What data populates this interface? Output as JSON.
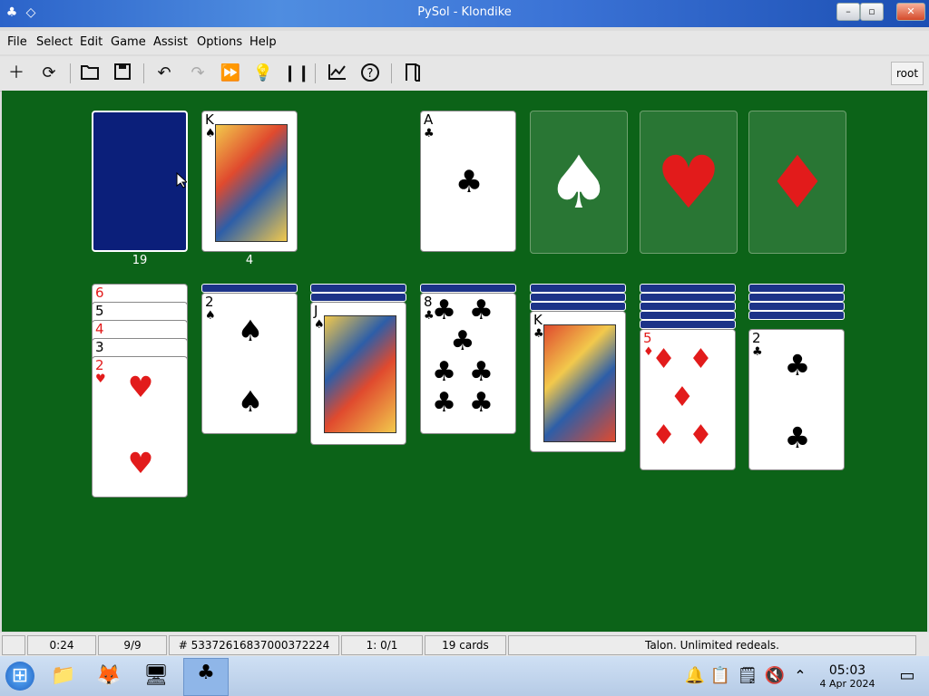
{
  "window": {
    "title": "PySol - Klondike"
  },
  "menu": [
    "File",
    "Select",
    "Edit",
    "Game",
    "Assist",
    "Options",
    "Help"
  ],
  "toolbar": {
    "user": "root"
  },
  "stock": {
    "count": "19"
  },
  "waste": {
    "count": "4",
    "top": {
      "rank": "K",
      "suit": "♠"
    }
  },
  "foundations": [
    {
      "rank": "A",
      "suit": "♣",
      "color": "#000000"
    },
    {
      "suit": "♠",
      "empty": true
    },
    {
      "suit": "♥",
      "empty": true,
      "color": "#e21b1b"
    },
    {
      "suit": "♦",
      "empty": true,
      "color": "#e21b1b"
    }
  ],
  "tableau": [
    {
      "hidden": 0,
      "cards": [
        {
          "rank": "6",
          "suit": "♥"
        },
        {
          "rank": "5",
          "suit": "♠"
        },
        {
          "rank": "4",
          "suit": "♥"
        },
        {
          "rank": "3",
          "suit": "♠"
        },
        {
          "rank": "2",
          "suit": "♥"
        }
      ]
    },
    {
      "hidden": 1,
      "cards": [
        {
          "rank": "2",
          "suit": "♠"
        }
      ]
    },
    {
      "hidden": 2,
      "cards": [
        {
          "rank": "J",
          "suit": "♠"
        }
      ]
    },
    {
      "hidden": 1,
      "cards": [
        {
          "rank": "8",
          "suit": "♣"
        }
      ]
    },
    {
      "hidden": 3,
      "cards": [
        {
          "rank": "K",
          "suit": "♣"
        }
      ]
    },
    {
      "hidden": 5,
      "cards": [
        {
          "rank": "5",
          "suit": "♦"
        }
      ]
    },
    {
      "hidden": 4,
      "cards": [
        {
          "rank": "2",
          "suit": "♣"
        }
      ]
    }
  ],
  "status": {
    "time": "0:24",
    "moves": "9/9",
    "game_number": "# 53372616837000372224",
    "score": "1: 0/1",
    "cards": "19 cards",
    "message": "Talon. Unlimited redeals."
  },
  "taskbar": {
    "time": "05:03",
    "date": "4 Apr 2024"
  }
}
